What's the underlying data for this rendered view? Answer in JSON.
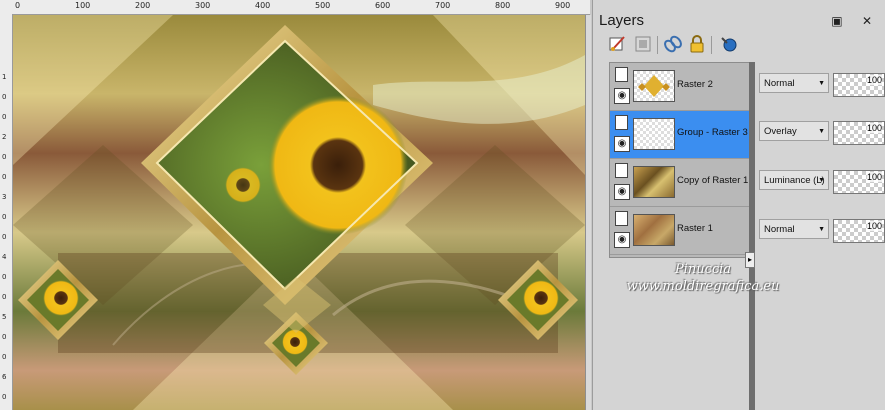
{
  "ruler": {
    "top_ticks": [
      "0",
      "100",
      "200",
      "300",
      "400",
      "500",
      "600",
      "700",
      "800",
      "900"
    ],
    "left_ticks": [
      "1",
      "0",
      "0",
      "2",
      "0",
      "0",
      "3",
      "0",
      "0",
      "4",
      "0",
      "0",
      "5",
      "0",
      "0",
      "6",
      "0"
    ]
  },
  "palette": {
    "title": "Layers",
    "window_controls": "▣ ✕",
    "layers": [
      {
        "name": "Raster 2",
        "blend": "Normal",
        "opacity": "100",
        "selected": false
      },
      {
        "name": "Group - Raster 3",
        "blend": "Overlay",
        "opacity": "100",
        "selected": true
      },
      {
        "name": "Copy of Raster 1",
        "blend": "Luminance (L)",
        "opacity": "100",
        "selected": false
      },
      {
        "name": "Raster 1",
        "blend": "Normal",
        "opacity": "100",
        "selected": false
      }
    ]
  },
  "icons": {
    "toolbar": [
      "brush-properties-icon",
      "mask-icon",
      "link-icon",
      "lock-icon",
      "new-layer-icon"
    ],
    "visibility": "eye-icon",
    "layer_doc": "document-icon",
    "dropdown": "chevron-down-icon"
  },
  "watermark": {
    "line1": "Pinuccia",
    "line2": "www.moldiregrafica.eu"
  },
  "colors": {
    "selection": "#3b8ef0",
    "panel": "#d4d4d4"
  }
}
